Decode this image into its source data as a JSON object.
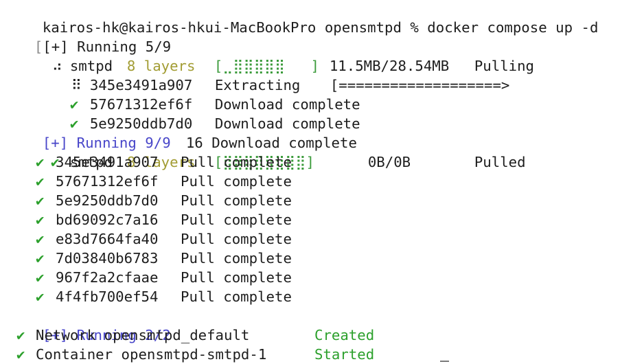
{
  "colors": {
    "background": "#ffffff",
    "text": "#1d1d1d",
    "blue": "#4846c9",
    "olive": "#a29c33",
    "green": "#2ca02c"
  },
  "icons": {
    "check": "checkmark-icon",
    "spinner": "spinner-icon"
  },
  "prompt": {
    "text": "kairos-hk@kairos-hkui-MacBookPro opensmtpd % docker compose up -d"
  },
  "running_first": {
    "open_bracket": "[",
    "label": "[+] Running 5/9"
  },
  "pulling": {
    "spinner": "⠴",
    "service": "smtpd",
    "layers": "8 layers",
    "bar": "[⣀⣿⣿⣿⣿⣿   ]",
    "size": "11.5MB/28.54MB",
    "status": "Pulling"
  },
  "extracting": {
    "spinner": "⠿",
    "id": "345e3491a907",
    "status": "Extracting",
    "progress": "[===================>"
  },
  "downloads": [
    {
      "check": "✔",
      "id": "57671312ef6f",
      "status": "Download complete"
    },
    {
      "check": "✔",
      "id": "5e9250ddb7d0",
      "status": "Download complete"
    }
  ],
  "running_second": {
    "label": "[+] Running 9/9",
    "overlap": "16 Download complete"
  },
  "pulled": {
    "check": "✔",
    "service": "smtpd",
    "layers": "8 layers",
    "bar": "[⣿⣿⣿⣿⣿⣿⣿⣿]",
    "size": "0B/0B",
    "status": "Pulled"
  },
  "layers": [
    {
      "check": "✔",
      "id": "345e3491a907",
      "status": "Pull complete"
    },
    {
      "check": "✔",
      "id": "57671312ef6f",
      "status": "Pull complete"
    },
    {
      "check": "✔",
      "id": "5e9250ddb7d0",
      "status": "Pull complete"
    },
    {
      "check": "✔",
      "id": "bd69092c7a16",
      "status": "Pull complete"
    },
    {
      "check": "✔",
      "id": "e83d7664fa40",
      "status": "Pull complete"
    },
    {
      "check": "✔",
      "id": "7d03840b6783",
      "status": "Pull complete"
    },
    {
      "check": "✔",
      "id": "967f2a2cfaae",
      "status": "Pull complete"
    },
    {
      "check": "✔",
      "id": "4f4fb700ef54",
      "status": "Pull complete"
    }
  ],
  "running_third": {
    "label": "[+] Running 2/2"
  },
  "resources": [
    {
      "check": "✔",
      "text": "Network opensmtpd_default",
      "status": "Created"
    },
    {
      "check": "✔",
      "text": "Container opensmtpd-smtpd-1",
      "status": "Started"
    }
  ]
}
